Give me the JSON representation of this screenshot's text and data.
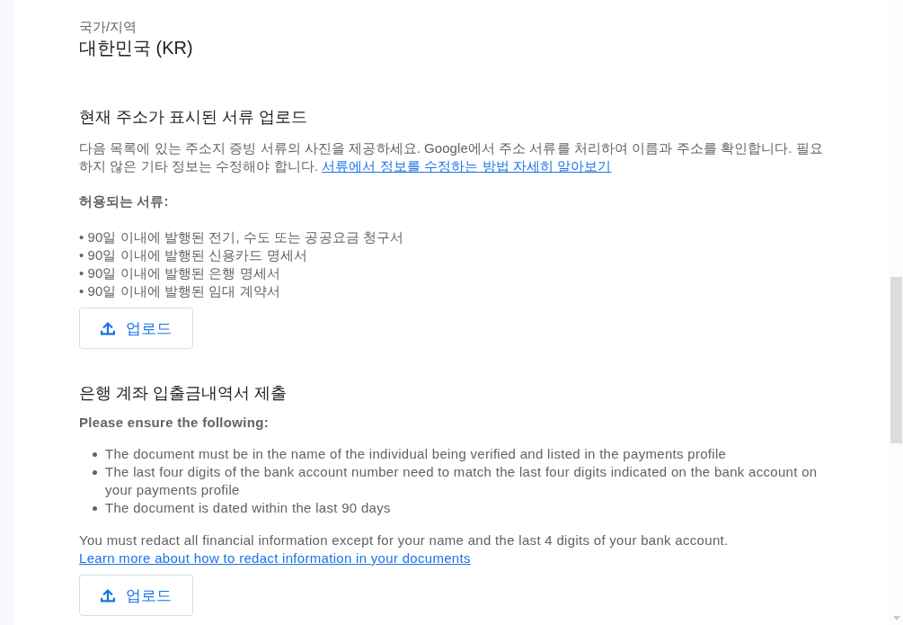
{
  "country": {
    "label": "국가/지역",
    "value": "대한민국 (KR)"
  },
  "sections": [
    {
      "kind": "plain",
      "title": "현재 주소가 표시된 서류 업로드",
      "description": {
        "text": "다음 목록에 있는 주소지 증빙 서류의 사진을 제공하세요. Google에서 주소 서류를 처리하여 이름과 주소를 확인합니다. 필요하지 않은 기타 정보는 수정해야 합니다.",
        "link": "서류에서 정보를 수정하는 방법 자세히 알아보기"
      },
      "list_heading": "허용되는 서류:",
      "items": [
        "• 90일 이내에 발행된 전기, 수도 또는 공공요금 청구서",
        "• 90일 이내에 발행된 신용카드 명세서",
        "• 90일 이내에 발행된 은행 명세서",
        "• 90일 이내에 발행된 임대 계약서"
      ],
      "upload_button": "업로드"
    },
    {
      "kind": "bulleted",
      "title": "은행 계좌 입출금내역서 제출",
      "list_heading": "Please ensure the following:",
      "items": [
        "The document must be in the name of the individual being verified and listed in the payments profile",
        "The last four digits of the bank account number need to match the last four digits indicated on the bank account on your payments profile",
        "The document is dated within the last 90 days"
      ],
      "note": {
        "text": "You must redact all financial information except for your name and the last 4 digits of your bank account.",
        "link": "Learn more about how to redact information in your documents"
      },
      "upload_button": "업로드"
    }
  ]
}
